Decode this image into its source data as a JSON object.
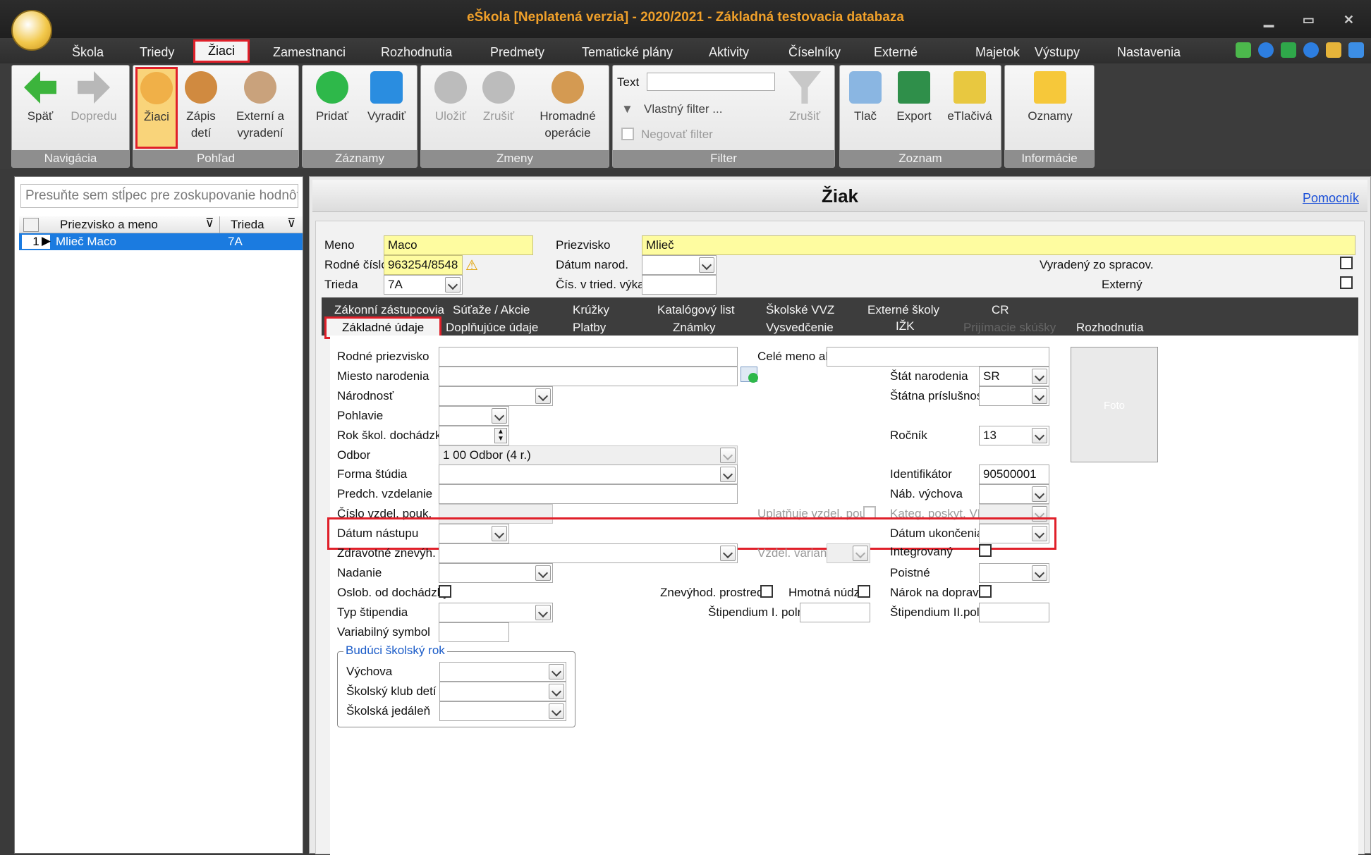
{
  "window": {
    "title": "eŠkola [Neplatená verzia] - 2020/2021 - Základná testovacia databaza"
  },
  "menu": [
    "Škola",
    "Triedy",
    "Žiaci",
    "Zamestnanci",
    "Rozhodnutia",
    "Predmety",
    "Tematické plány",
    "Aktivity",
    "Číselníky",
    "Externé",
    "Majetok",
    "Výstupy",
    "Nastavenia"
  ],
  "ribbon": {
    "navigacia": {
      "label": "Navigácia",
      "back": "Späť",
      "forward": "Dopredu"
    },
    "pohlad": {
      "label": "Pohľad",
      "ziaci": "Žiaci",
      "zapis1": "Zápis",
      "zapis2": "detí",
      "ext1": "Externí a",
      "ext2": "vyradení"
    },
    "zaznamy": {
      "label": "Záznamy",
      "add": "Pridať",
      "remove": "Vyradiť"
    },
    "zmeny": {
      "label": "Zmeny",
      "save": "Uložiť",
      "cancel": "Zrušiť",
      "bulk1": "Hromadné",
      "bulk2": "operácie"
    },
    "filter": {
      "label": "Filter",
      "text": "Text",
      "custom": "Vlastný filter ...",
      "negate": "Negovať filter",
      "cancel": "Zrušiť"
    },
    "zoznam": {
      "label": "Zoznam",
      "print": "Tlač",
      "export": "Export",
      "eprint": "eTlačivá"
    },
    "info": {
      "label": "Informácie",
      "notices": "Oznamy"
    }
  },
  "left": {
    "group_placeholder": "Presuňte sem stĺpec pre zoskupovanie hodnôt",
    "col_name": "Priezvisko a meno",
    "col_class": "Trieda",
    "rows": [
      {
        "n": "1",
        "name": "Mlieč Maco",
        "cls": "7A"
      }
    ]
  },
  "form": {
    "title": "Žiak",
    "help": "Pomocník",
    "meno_l": "Meno",
    "meno": "Maco",
    "priezvisko_l": "Priezvisko",
    "priezvisko": "Mlieč",
    "rc_l": "Rodné číslo",
    "rc": "963254/8548",
    "datum_narod_l": "Dátum narod.",
    "trieda_l": "Trieda",
    "trieda": "7A",
    "cis_l": "Čís. v tried. výkaze",
    "vyradeny_l": "Vyradený zo spracov.",
    "externy_l": "Externý"
  },
  "tabs_row1": [
    "Zákonní zástupcovia",
    "Súťaže / Akcie",
    "Krúžky",
    "Katalógový list",
    "Školské VVZ",
    "Externé školy",
    "CR"
  ],
  "tabs_row2": [
    "Základné údaje",
    "Doplňujúce údaje",
    "Platby",
    "Známky",
    "Vysvedčenie",
    "IŽK",
    "Prijímacie skúšky",
    "Rozhodnutia"
  ],
  "fields": {
    "rodne_priezvisko": "Rodné priezvisko",
    "cele_meno_alt": "Celé meno alt.",
    "miesto_narodenia": "Miesto narodenia",
    "stat_narodenia": "Štát narodenia",
    "stat_narodenia_v": "SR",
    "narodnost": "Národnosť",
    "statna_prisl": "Štátna príslušnosť",
    "pohlavie": "Pohlavie",
    "rok_skol": "Rok škol. dochádzky",
    "rocnik": "Ročník",
    "rocnik_v": "13",
    "odbor": "Odbor",
    "odbor_v": "1 00 Odbor (4 r.)",
    "forma": "Forma štúdia",
    "identifikator": "Identifikátor",
    "identifikator_v": "90500001",
    "predch": "Predch. vzdelanie",
    "nab": "Náb. výchova",
    "cislo_pouk": "Číslo vzdel. pouk.",
    "uplatnuje": "Uplatňuje vzdel. pouk.",
    "kateg": "Kateg. poskyt. VP",
    "datum_nastupu": "Dátum nástupu",
    "datum_ukoncenia": "Dátum ukončenia",
    "zdravotne": "Zdravotné znevýh.",
    "vzdel_variant": "Vzdel. variant",
    "integrovany": "Integrovaný",
    "nadanie": "Nadanie",
    "poistne": "Poistné",
    "oslob": "Oslob. od dochádzky",
    "znevyhod": "Znevýhod. prostredie",
    "hmotna": "Hmotná núdza",
    "narok": "Nárok na dopravné",
    "typ_stip": "Typ štipendia",
    "stip1": "Štipendium I. polrok",
    "stip2": "Štipendium II.polrok",
    "var_symbol": "Variabilný symbol",
    "foto": "Foto",
    "buduci": "Budúci školský rok",
    "vychova": "Výchova",
    "klub": "Školský klub detí",
    "jedalen": "Školská jedáleň"
  },
  "colors": {
    "accent_red": "#e0202a",
    "title_orange": "#f0a02a",
    "selection": "#1b7be0",
    "required_yellow": "#fefca0"
  }
}
